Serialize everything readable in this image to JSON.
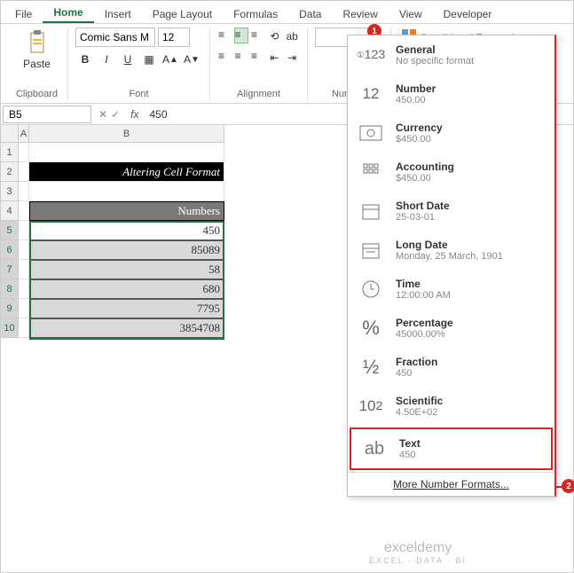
{
  "tabs": [
    "File",
    "Home",
    "Insert",
    "Page Layout",
    "Formulas",
    "Data",
    "Review",
    "View",
    "Developer"
  ],
  "active_tab": "Home",
  "ribbon": {
    "clipboard": {
      "label": "Clipboard",
      "paste": "Paste"
    },
    "font": {
      "label": "Font",
      "name": "Comic Sans M",
      "size": "12"
    },
    "alignment": {
      "label": "Alignment"
    },
    "number_group_label": "Number",
    "conditional": "Conditional Formatting"
  },
  "namebox": "B5",
  "formula": "450",
  "cols": [
    "A",
    "B"
  ],
  "rows": [
    "1",
    "2",
    "3",
    "4",
    "5",
    "6",
    "7",
    "8",
    "9",
    "10"
  ],
  "title_text": "Altering Cell Format",
  "header_text": "Numbers",
  "data": [
    "450",
    "85089",
    "58",
    "680",
    "7795",
    "3854708"
  ],
  "dropdown": {
    "items": [
      {
        "icon": "123",
        "title": "General",
        "sub": "No specific format"
      },
      {
        "icon": "12",
        "title": "Number",
        "sub": "450.00"
      },
      {
        "icon": "cash",
        "title": "Currency",
        "sub": "$450.00"
      },
      {
        "icon": "acct",
        "title": "Accounting",
        "sub": " $450.00 "
      },
      {
        "icon": "cal",
        "title": "Short Date",
        "sub": "25-03-01"
      },
      {
        "icon": "cal2",
        "title": "Long Date",
        "sub": "Monday, 25 March, 1901"
      },
      {
        "icon": "clk",
        "title": "Time",
        "sub": "12:00:00 AM"
      },
      {
        "icon": "%",
        "title": "Percentage",
        "sub": "45000.00%"
      },
      {
        "icon": "½",
        "title": "Fraction",
        "sub": "450"
      },
      {
        "icon": "10²",
        "title": "Scientific",
        "sub": "4.50E+02"
      },
      {
        "icon": "ab",
        "title": "Text",
        "sub": "450"
      }
    ],
    "more": "More Number Formats..."
  },
  "callouts": {
    "one": "1",
    "two": "2"
  },
  "watermark": {
    "main": "exceldemy",
    "sub": "EXCEL · DATA · BI"
  }
}
